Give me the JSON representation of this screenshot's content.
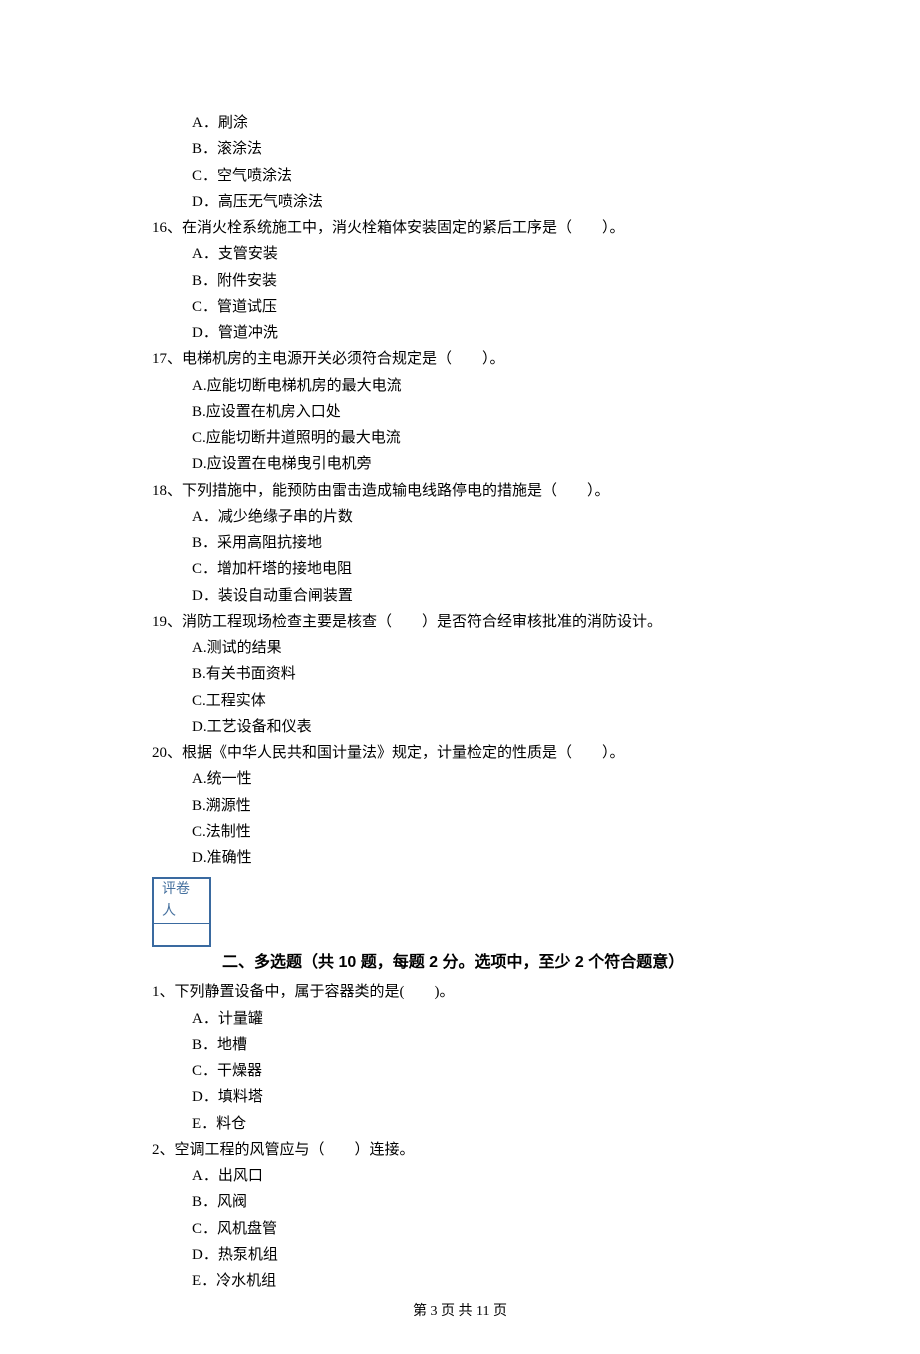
{
  "q15_options": {
    "A": "A．刷涂",
    "B": "B．滚涂法",
    "C": "C．空气喷涂法",
    "D": "D．高压无气喷涂法"
  },
  "q16": {
    "stem": "16、在消火栓系统施工中，消火栓箱体安装固定的紧后工序是（　　）。",
    "A": "A．支管安装",
    "B": "B．附件安装",
    "C": "C．管道试压",
    "D": "D．管道冲洗"
  },
  "q17": {
    "stem": "17、电梯机房的主电源开关必须符合规定是（　　）。",
    "A": "A.应能切断电梯机房的最大电流",
    "B": "B.应设置在机房入口处",
    "C": "C.应能切断井道照明的最大电流",
    "D": "D.应设置在电梯曳引电机旁"
  },
  "q18": {
    "stem": "18、下列措施中，能预防由雷击造成输电线路停电的措施是（　　）。",
    "A": "A．减少绝缘子串的片数",
    "B": "B．采用高阻抗接地",
    "C": "C．增加杆塔的接地电阻",
    "D": "D．装设自动重合闸装置"
  },
  "q19": {
    "stem": "19、消防工程现场检查主要是核查（　　）是否符合经审核批准的消防设计。",
    "A": "A.测试的结果",
    "B": "B.有关书面资料",
    "C": "C.工程实体",
    "D": "D.工艺设备和仪表"
  },
  "q20": {
    "stem": "20、根据《中华人民共和国计量法》规定，计量检定的性质是（　　）。",
    "A": "A.统一性",
    "B": "B.溯源性",
    "C": "C.法制性",
    "D": "D.准确性"
  },
  "grader_label": "评卷人",
  "section2_title": "二、多选题（共 10 题，每题 2 分。选项中，至少 2 个符合题意）",
  "m1": {
    "stem": "1、下列静置设备中，属于容器类的是(　　)。",
    "A": "A．计量罐",
    "B": "B．地槽",
    "C": "C．干燥器",
    "D": "D．填料塔",
    "E": "E．料仓"
  },
  "m2": {
    "stem": "2、空调工程的风管应与（　　）连接。",
    "A": "A．出风口",
    "B": "B．风阀",
    "C": "C．风机盘管",
    "D": "D．热泵机组",
    "E": "E．冷水机组"
  },
  "footer": "第 3 页 共 11 页"
}
